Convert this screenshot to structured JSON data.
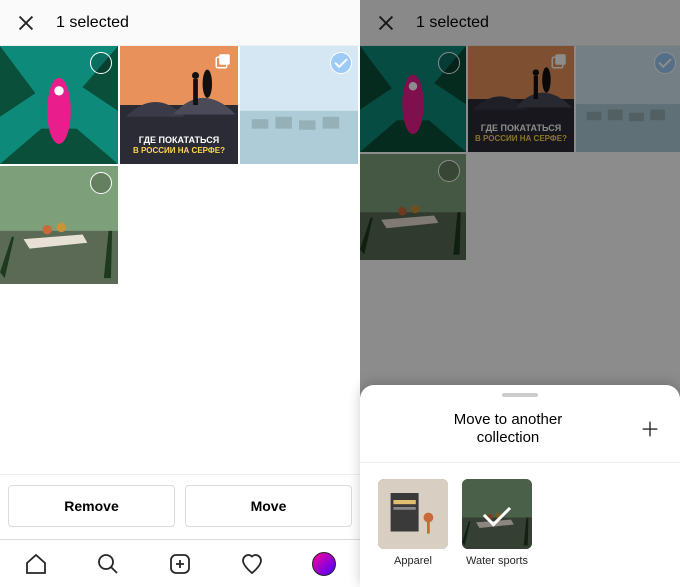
{
  "left": {
    "header_title": "1 selected",
    "thumbs": [
      {
        "kind": "aerial",
        "multi": false,
        "selected": false,
        "faded": false,
        "text1": "",
        "text2": ""
      },
      {
        "kind": "surfer",
        "multi": true,
        "selected": false,
        "faded": false,
        "text1": "ГДЕ ПОКАТАТЬСЯ",
        "text2": "В РОССИИ НА СЕРФЕ?"
      },
      {
        "kind": "beach",
        "multi": false,
        "selected": true,
        "faded": true,
        "text1": "",
        "text2": ""
      },
      {
        "kind": "boat",
        "multi": false,
        "selected": false,
        "faded": false,
        "text1": "",
        "text2": ""
      }
    ],
    "remove_label": "Remove",
    "move_label": "Move"
  },
  "right": {
    "header_title": "1 selected",
    "thumbs": [
      {
        "kind": "aerial",
        "multi": false,
        "selected": false,
        "faded": false,
        "text1": "",
        "text2": ""
      },
      {
        "kind": "surfer",
        "multi": true,
        "selected": false,
        "faded": false,
        "text1": "ГДЕ ПОКАТАТЬСЯ",
        "text2": "В РОССИИ НА СЕРФЕ?"
      },
      {
        "kind": "beach",
        "multi": false,
        "selected": true,
        "faded": true,
        "text1": "",
        "text2": ""
      },
      {
        "kind": "boat",
        "multi": false,
        "selected": false,
        "faded": false,
        "text1": "",
        "text2": ""
      }
    ],
    "sheet_title": "Move to another collection",
    "collections": [
      {
        "name": "Apparel",
        "kind": "apparel",
        "selected": false
      },
      {
        "name": "Water sports",
        "kind": "boat",
        "selected": true
      }
    ]
  }
}
